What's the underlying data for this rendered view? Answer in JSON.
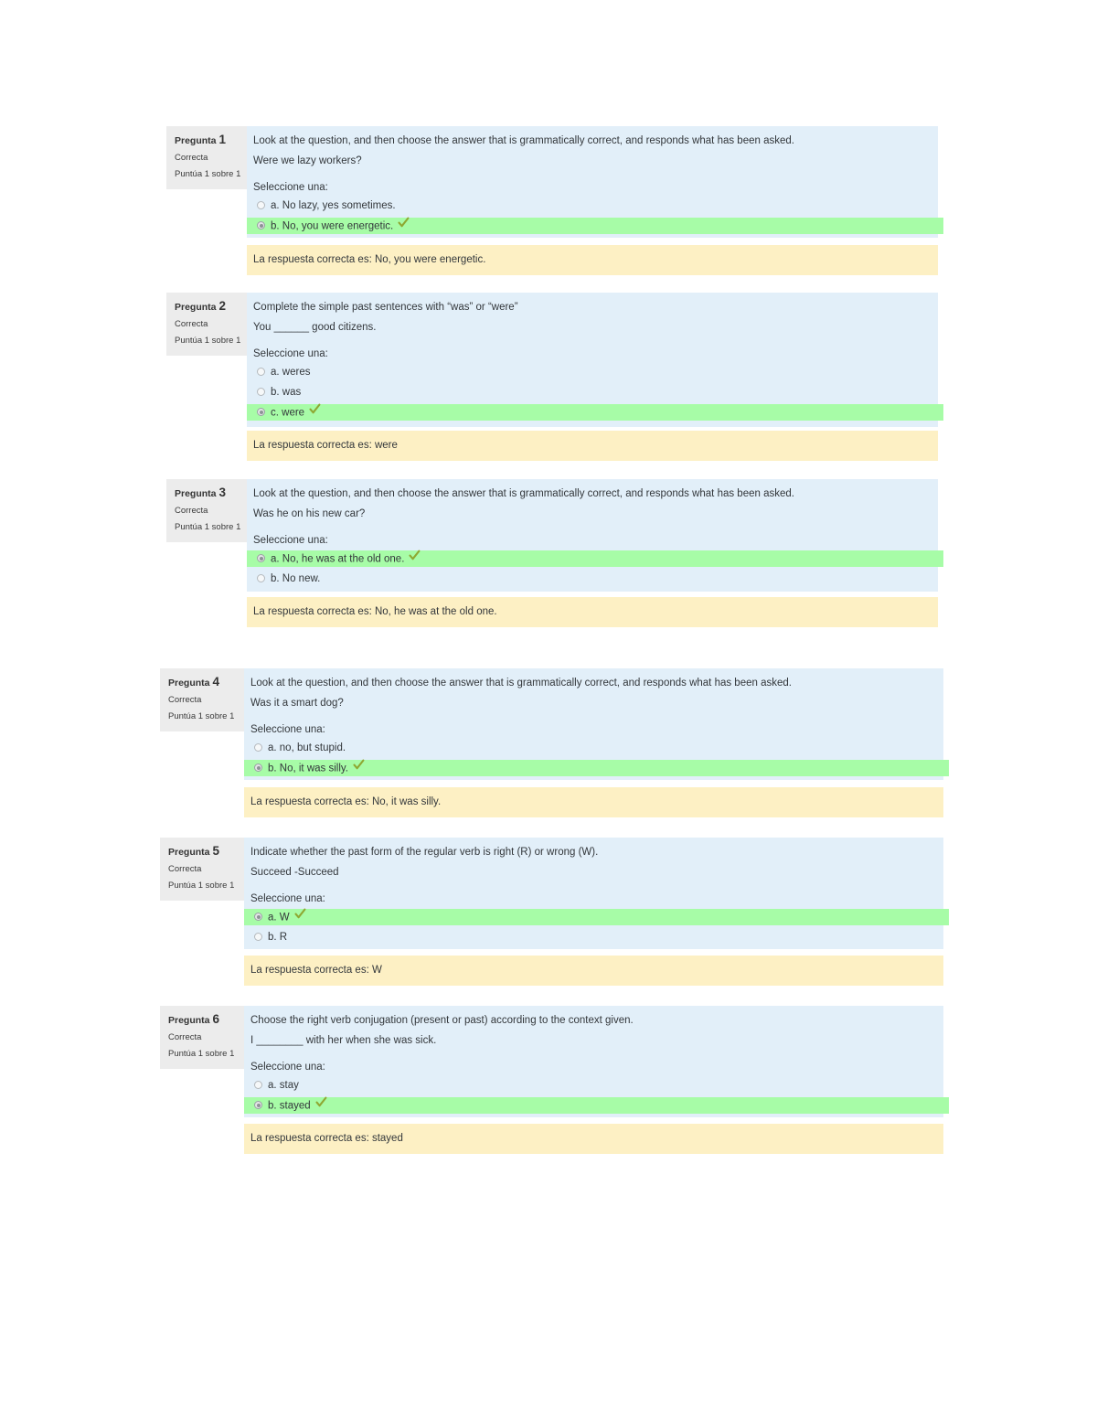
{
  "page": {
    "background": "#ffffff",
    "panel_color": "#e2eff9",
    "info_color": "#ececec",
    "correct_color": "#a7fca7",
    "feedback_color": "#fdf0c4",
    "tick_color": "#8ea832"
  },
  "labels": {
    "question_word": "Pregunta",
    "select_one": "Seleccione una:",
    "state": "Correcta",
    "grade": "Puntúa 1 sobre 1"
  },
  "questions": [
    {
      "number": "1",
      "state": "Correcta",
      "grade": "Puntúa 1 sobre 1",
      "stem_line1": "Look at the question, and then choose the answer that is grammatically correct, and responds what has been asked.",
      "stem_line2": "Were we lazy workers?",
      "prompt": "Seleccione una:",
      "options": [
        {
          "label": "a. No lazy, yes sometimes.",
          "selected": false,
          "correct": false
        },
        {
          "label": "b. No, you were energetic.",
          "selected": true,
          "correct": true
        }
      ],
      "feedback": "La respuesta correcta es: No, you were energetic."
    },
    {
      "number": "2",
      "state": "Correcta",
      "grade": "Puntúa 1 sobre 1",
      "stem_line1": "Complete the simple past sentences with “was” or “were”",
      "stem_line2": "You ______ good citizens.",
      "prompt": "Seleccione una:",
      "options": [
        {
          "label": "a. weres",
          "selected": false,
          "correct": false
        },
        {
          "label": "b. was",
          "selected": false,
          "correct": false
        },
        {
          "label": "c. were",
          "selected": true,
          "correct": true
        }
      ],
      "feedback": "La respuesta correcta es: were"
    },
    {
      "number": "3",
      "state": "Correcta",
      "grade": "Puntúa 1 sobre 1",
      "stem_line1": "Look at the question, and then choose the answer that is grammatically correct, and responds what has been asked.",
      "stem_line2": "Was he on his new car?",
      "prompt": "Seleccione una:",
      "options": [
        {
          "label": "a. No, he was at the old one.",
          "selected": true,
          "correct": true
        },
        {
          "label": "b. No new.",
          "selected": false,
          "correct": false
        }
      ],
      "feedback": "La respuesta correcta es: No, he was at the old one."
    },
    {
      "number": "4",
      "state": "Correcta",
      "grade": "Puntúa 1 sobre 1",
      "stem_line1": "Look at the question, and then choose the answer that is grammatically correct, and responds what has been asked.",
      "stem_line2": "Was it a smart dog?",
      "prompt": "Seleccione una:",
      "options": [
        {
          "label": "a. no, but stupid.",
          "selected": false,
          "correct": false
        },
        {
          "label": "b. No, it was silly.",
          "selected": true,
          "correct": true
        }
      ],
      "feedback": "La respuesta correcta es: No, it was silly."
    },
    {
      "number": "5",
      "state": "Correcta",
      "grade": "Puntúa 1 sobre 1",
      "stem_line1": "Indicate whether the past form of the regular verb is right (R) or wrong (W).",
      "stem_line2": "Succeed -Succeed",
      "prompt": "Seleccione una:",
      "options": [
        {
          "label": "a. W",
          "selected": true,
          "correct": true
        },
        {
          "label": "b. R",
          "selected": false,
          "correct": false
        }
      ],
      "feedback": "La respuesta correcta es: W"
    },
    {
      "number": "6",
      "state": "Correcta",
      "grade": "Puntúa 1 sobre 1",
      "stem_line1": "Choose the right verb conjugation (present or past) according to the context given.",
      "stem_line2": "I ________ with her when she was sick.",
      "prompt": "Seleccione una:",
      "options": [
        {
          "label": "a. stay",
          "selected": false,
          "correct": false
        },
        {
          "label": "b. stayed",
          "selected": true,
          "correct": true
        }
      ],
      "feedback": "La respuesta correcta es: stayed"
    }
  ]
}
